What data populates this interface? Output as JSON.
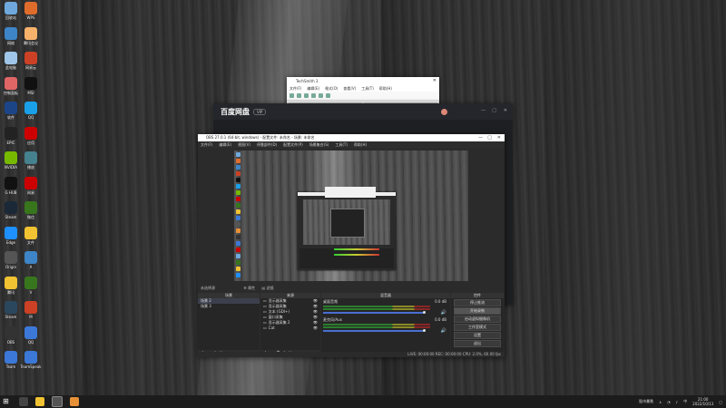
{
  "desktop": {
    "icons_col1": [
      {
        "label": "回收站",
        "icon": "recycle-bin-icon",
        "color": "#6fa8dc"
      },
      {
        "label": "网络",
        "icon": "network-icon",
        "color": "#3d85c6"
      },
      {
        "label": "此电脑",
        "icon": "computer-icon",
        "color": "#9fc5e8"
      },
      {
        "label": "控制面板",
        "icon": "control-panel-icon",
        "color": "#e06666"
      },
      {
        "label": "软件",
        "icon": "folder-icon",
        "color": "#1c4587"
      },
      {
        "label": "EPIC",
        "icon": "epic-games-icon",
        "color": "#222222"
      },
      {
        "label": "NVIDIA",
        "icon": "nvidia-icon",
        "color": "#76b900"
      },
      {
        "label": "G HUB",
        "icon": "ghub-icon",
        "color": "#111111"
      },
      {
        "label": "Steam",
        "icon": "steam-icon",
        "color": "#1b2838"
      },
      {
        "label": "Edge",
        "icon": "edge-icon",
        "color": "#1e90ff"
      },
      {
        "label": "Origin",
        "icon": "origin-icon",
        "color": "#555555"
      },
      {
        "label": "腾讯",
        "icon": "tencent-icon",
        "color": "#f1c232"
      },
      {
        "label": "Steam",
        "icon": "steam-icon",
        "color": "#2a475e"
      },
      {
        "label": "OBS",
        "icon": "obs-icon",
        "color": "#333333"
      },
      {
        "label": "Team",
        "icon": "team-icon",
        "color": "#3c78d8"
      }
    ],
    "icons_col2": [
      {
        "label": "WPS",
        "icon": "wps-icon",
        "color": "#e06c2c"
      },
      {
        "label": "腾讯会议",
        "icon": "meeting-icon",
        "color": "#f6b26b"
      },
      {
        "label": "网易云",
        "icon": "music-icon",
        "color": "#cc4125"
      },
      {
        "label": "MSI",
        "icon": "msi-icon",
        "color": "#111111"
      },
      {
        "label": "QQ",
        "icon": "qq-icon",
        "color": "#1aa0e8"
      },
      {
        "label": "应用",
        "icon": "app-icon",
        "color": "#cc0000"
      },
      {
        "label": "播放",
        "icon": "player-icon",
        "color": "#45818e"
      },
      {
        "label": "网易",
        "icon": "netease-icon",
        "color": "#cc0000"
      },
      {
        "label": "微信",
        "icon": "wechat-icon",
        "color": "#38761d"
      },
      {
        "label": "文件",
        "icon": "file-icon",
        "color": "#f1c232"
      },
      {
        "label": "A",
        "icon": "a-icon",
        "color": "#3d85c6"
      },
      {
        "label": "V",
        "icon": "v-icon",
        "color": "#38761d"
      },
      {
        "label": "M",
        "icon": "m-icon",
        "color": "#cc4125"
      },
      {
        "label": "QQ",
        "icon": "qq-icon",
        "color": "#3c78d8"
      },
      {
        "label": "TeamSpeak",
        "icon": "teamspeak-icon",
        "color": "#3c78d8"
      }
    ]
  },
  "notepad": {
    "title": "TechSmith 3",
    "menu": [
      "文件(F)",
      "编辑(E)",
      "格式(O)",
      "查看(V)",
      "工具(T)",
      "帮助(H)"
    ]
  },
  "player": {
    "brand": "百度网盘",
    "badge": "VIP"
  },
  "obs": {
    "title": "OBS 27.0.1 (64-bit, windows) - 配置文件: 未命名 - 场景: 未命名",
    "menu": [
      "文件(F)",
      "编辑(E)",
      "视图(V)",
      "停靠部件(D)",
      "配置文件(P)",
      "场景集合(S)",
      "工具(T)",
      "帮助(H)"
    ],
    "preview_bar": {
      "label": "未选择源",
      "properties": "属性",
      "filters": "滤镜"
    },
    "scenes": {
      "header": "场景",
      "items": [
        "场景 2",
        "场景 3"
      ]
    },
    "sources": {
      "header": "来源",
      "items": [
        "显示器采集",
        "显示器采集",
        "文本 (GDI+)",
        "窗口采集",
        "显示器采集 2",
        "Cat"
      ]
    },
    "mixer": {
      "header": "混音器",
      "channels": [
        {
          "name": "桌面音频",
          "db": "0.0 dB"
        },
        {
          "name": "麦克风/Aux",
          "db": "0.0 dB"
        }
      ]
    },
    "controls": {
      "header": "控件",
      "buttons": [
        "停止推流",
        "开始录制",
        "启动虚拟摄像机",
        "工作室模式",
        "设置",
        "退出"
      ]
    },
    "status": "LIVE: 00:00:00   REC: 00:00:00   CPU: 2.0%, 60.00 fps",
    "dock_footer_scenes": "+  −  ∧  ∨",
    "dock_footer_sources": "+  −  ⚙  ∧  ∨",
    "stream_label": "推流",
    "record_label": "录制"
  },
  "taskbar": {
    "apps": [
      "search",
      "file-explorer",
      "obs",
      "folder"
    ],
    "tray_text": "股市暴跌",
    "time": "21:00",
    "date": "2022/10/13"
  }
}
